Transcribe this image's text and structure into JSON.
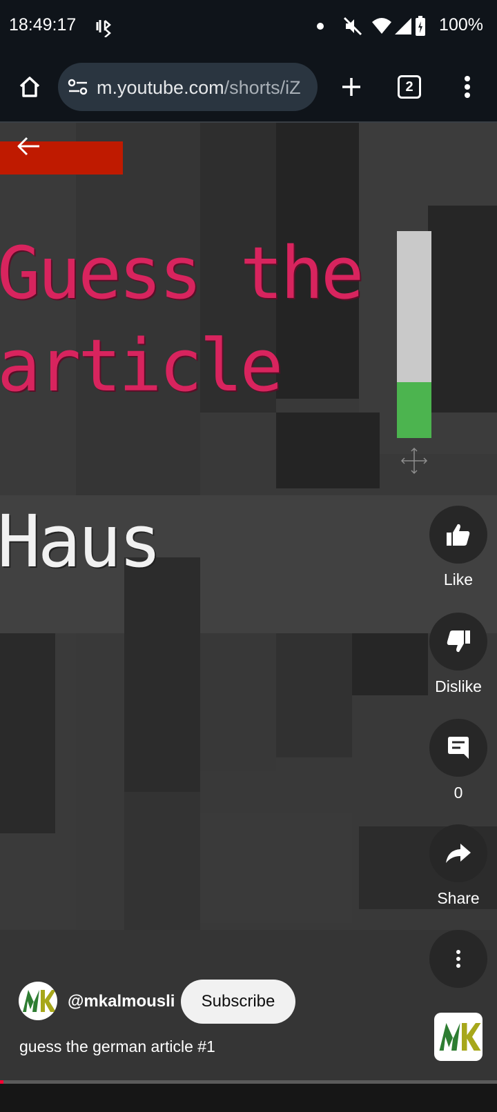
{
  "status_bar": {
    "time": "18:49:17",
    "battery": "100%",
    "icons": [
      "bluetooth-audio-icon",
      "dot-icon",
      "mute-icon",
      "wifi-icon",
      "cell-signal-icon",
      "battery-icon"
    ]
  },
  "browser": {
    "url_domain": "m.youtube.com",
    "url_path": "/shorts/iZ",
    "tab_count": "2",
    "icons": [
      "home-icon",
      "site-settings-icon",
      "new-tab-icon",
      "tab-switcher-icon",
      "more-menu-icon"
    ]
  },
  "video": {
    "title_line1": "Guess the",
    "title_line2": "article",
    "word": "Haus",
    "meter_fill_fraction": 0.27,
    "colors": {
      "title": "#d8245e",
      "meter_fill": "#4cb44f",
      "red_bar": "#bf1a00"
    }
  },
  "actions": {
    "like_label": "Like",
    "dislike_label": "Dislike",
    "comments_count": "0",
    "share_label": "Share"
  },
  "channel": {
    "handle": "@mkalmousli",
    "subscribe_label": "Subscribe",
    "video_title": "guess the german article #1"
  },
  "playback": {
    "progress_fraction": 0.007,
    "progress_color": "#ff0033"
  }
}
